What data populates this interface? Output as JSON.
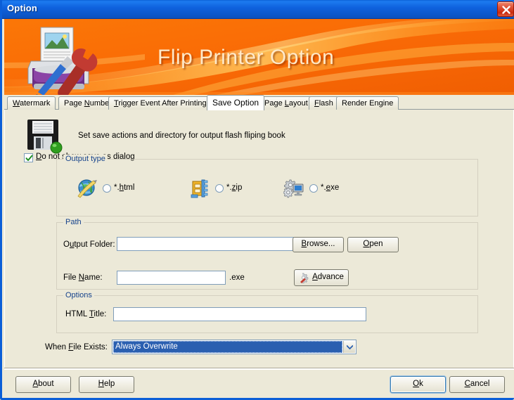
{
  "window": {
    "title": "Option",
    "close_label": "Close"
  },
  "banner": {
    "title": "Flip Printer Option"
  },
  "tabs": [
    {
      "label": "Watermark",
      "accel": "W",
      "active": false
    },
    {
      "label": "Page Number",
      "accel": "N",
      "active": false
    },
    {
      "label": "Trigger Event After Printing",
      "accel": "T",
      "active": false
    },
    {
      "label": "Save Option",
      "accel": "",
      "active": true
    },
    {
      "label": "Page Layout",
      "accel": "L",
      "active": false
    },
    {
      "label": "Flash",
      "accel": "F",
      "active": false
    },
    {
      "label": "Render Engine",
      "accel": "",
      "active": false
    }
  ],
  "header": {
    "description": "Set save actions and directory for output flash fliping book",
    "icon": "floppy-disk-icon"
  },
  "dialog_checkbox": {
    "label": "Do not show save as dialog",
    "checked": true
  },
  "output_type": {
    "group_label": "Output type",
    "options": [
      {
        "label": "*.html",
        "icon": "world-globe-icon",
        "selected": false
      },
      {
        "label": "*.zip",
        "icon": "zip-archive-icon",
        "selected": false
      },
      {
        "label": "*.exe",
        "icon": "gears-monitor-icon",
        "selected": false
      }
    ]
  },
  "path": {
    "group_label": "Path",
    "output_folder_label": "Output Folder:",
    "output_folder_value": "",
    "browse_label": "Browse...",
    "open_label": "Open",
    "file_name_label": "File Name:",
    "file_name_value": "",
    "file_name_suffix": ".exe",
    "advance_label": "Advance"
  },
  "options": {
    "group_label": "Options",
    "html_title_label": "HTML Title:",
    "html_title_value": ""
  },
  "when_file_exists": {
    "label": "When File Exists:",
    "value": "Always Overwrite"
  },
  "footer": {
    "about_label": "About",
    "help_label": "Help",
    "ok_label": "Ok",
    "cancel_label": "Cancel"
  },
  "colors": {
    "banner_orange": "#f96a06",
    "titlebar_blue": "#0f62de",
    "group_label_blue": "#15428b",
    "selection_blue": "#2a5fb0",
    "window_face": "#ece9d8"
  }
}
